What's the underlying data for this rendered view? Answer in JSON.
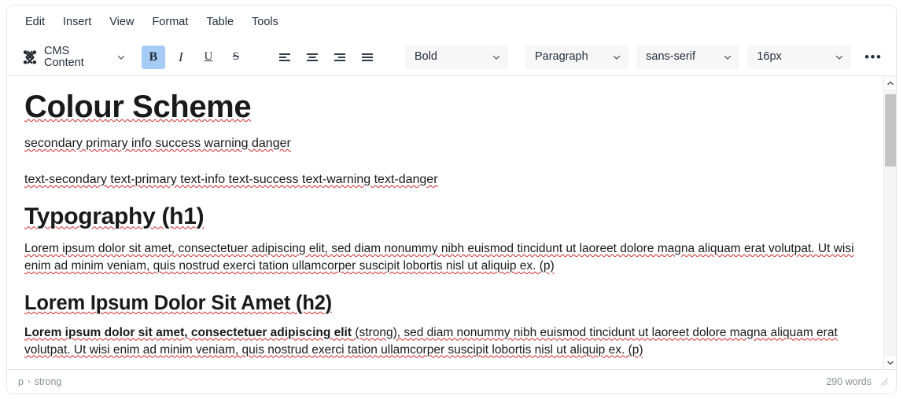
{
  "menubar": {
    "items": [
      {
        "label": "Edit",
        "name": "menu-edit"
      },
      {
        "label": "Insert",
        "name": "menu-insert"
      },
      {
        "label": "View",
        "name": "menu-view"
      },
      {
        "label": "Format",
        "name": "menu-format"
      },
      {
        "label": "Table",
        "name": "menu-table"
      },
      {
        "label": "Tools",
        "name": "menu-tools"
      }
    ]
  },
  "toolbar": {
    "cms_content_label": "CMS Content",
    "cms_icon": "joomla-logo-icon",
    "bold_glyph": "B",
    "italic_glyph": "I",
    "underline_glyph": "U",
    "strike_glyph": "S",
    "bold_active": true,
    "align": [
      {
        "name": "align-left-icon",
        "label": "Align left"
      },
      {
        "name": "align-center-icon",
        "label": "Align center"
      },
      {
        "name": "align-right-icon",
        "label": "Align right"
      },
      {
        "name": "align-justify-icon",
        "label": "Justify"
      }
    ],
    "selects": [
      {
        "name": "style-select",
        "value": "Bold"
      },
      {
        "name": "block-select",
        "value": "Paragraph"
      },
      {
        "name": "font-select",
        "value": "sans-serif"
      },
      {
        "name": "fontsize-select",
        "value": "16px"
      }
    ],
    "more_label": "•••"
  },
  "document": {
    "h1": "Colour Scheme",
    "swatches_bg": "secondary primary info success warning danger",
    "swatches_text": "text-secondary text-primary text-info text-success text-warning text-danger",
    "typography_heading": "Typography (h1)",
    "paragraph_1": "Lorem ipsum dolor sit amet, consectetuer adipiscing elit, sed diam nonummy nibh euismod tincidunt ut laoreet dolore magna aliquam erat volutpat. Ut wisi enim ad minim veniam, quis nostrud exerci tation ullamcorper suscipit lobortis nisl ut aliquip ex. (p)",
    "h2": "Lorem Ipsum Dolor Sit Amet (h2)",
    "paragraph_2_strong": "Lorem ipsum dolor sit amet, consectetuer adipiscing elit",
    "paragraph_2_rest": " (strong), sed diam nonummy nibh euismod tincidunt ut laoreet dolore magna aliquam erat volutpat. Ut wisi enim ad minim veniam, quis nostrud exerci tation ullamcorper suscipit lobortis nisl ut aliquip ex. (p)"
  },
  "statusbar": {
    "path_root": "p",
    "path_separator": "›",
    "path_leaf": "strong",
    "wordcount": "290 words"
  },
  "colors": {
    "accent_active": "#a6ccf5",
    "text": "#222f3e",
    "muted": "#8a8f95",
    "border": "#e3e5e8",
    "spellcheck": "#cf2a2a",
    "scroll_thumb": "#c4c4c4"
  }
}
